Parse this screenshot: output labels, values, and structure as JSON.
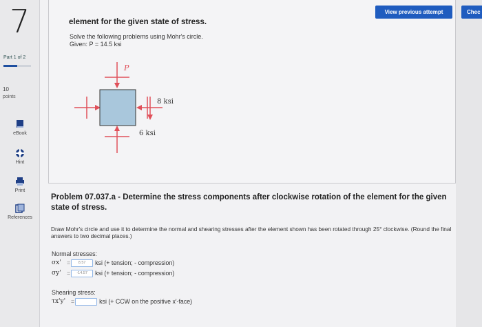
{
  "rail": {
    "question_number": "7",
    "part_label": "Part 1 of 2",
    "points_value": "10",
    "points_label": "points",
    "tools": [
      {
        "label": "eBook",
        "icon": "book-icon"
      },
      {
        "label": "Hint",
        "icon": "hint-icon"
      },
      {
        "label": "Print",
        "icon": "print-icon"
      },
      {
        "label": "References",
        "icon": "references-icon"
      }
    ]
  },
  "header": {
    "view_previous": "View previous attempt",
    "check": "Chec"
  },
  "figure_section": {
    "title": "element for the given state of stress.",
    "instruction": "Solve the following problems using Mohr's circle.",
    "given": "Given: P = 14.5 ksi",
    "labels": {
      "p": "P",
      "right": "8 ksi",
      "bottom": "6 ksi"
    }
  },
  "problem": {
    "title": "Problem 07.037.a - Determine the stress components after clockwise rotation of the element for the given state of stress.",
    "instruction": "Draw Mohr's circle and use it to determine the normal and shearing stresses after the element shown has been rotated through 25° clockwise. (Round the final answers to two decimal places.)",
    "normal_header": "Normal stresses:",
    "sigma_x_symbol": "σx'",
    "sigma_x_value": "8.57",
    "sigma_y_symbol": "σy'",
    "sigma_y_value": "-14.57",
    "unit_suffix": "ksi  (+ tension; - compression)",
    "shear_header": "Shearing stress:",
    "tau_symbol": "τx'y'",
    "tau_value": "",
    "tau_suffix": "ksi  (+ CCW on the positive x'-face)"
  },
  "colors": {
    "accent": "#1f5cbf",
    "element_fill": "#a9c7dc",
    "arrow": "#e0505a"
  }
}
